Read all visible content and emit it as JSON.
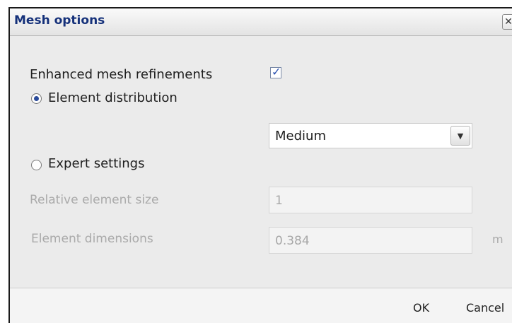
{
  "dialog": {
    "title": "Mesh options",
    "close_label": "✕"
  },
  "options": {
    "enhanced_refinements_label": "Enhanced mesh refinements",
    "enhanced_refinements_checked": true,
    "element_distribution_label": "Element distribution",
    "element_distribution_selected": true,
    "distribution_value": "Medium",
    "expert_settings_label": "Expert settings",
    "expert_settings_selected": false,
    "relative_size_label": "Relative element size",
    "relative_size_value": "1",
    "element_dimensions_label": "Element dimensions",
    "element_dimensions_value": "0.384",
    "element_dimensions_unit": "m"
  },
  "footer": {
    "ok_label": "OK",
    "cancel_label": "Cancel"
  }
}
